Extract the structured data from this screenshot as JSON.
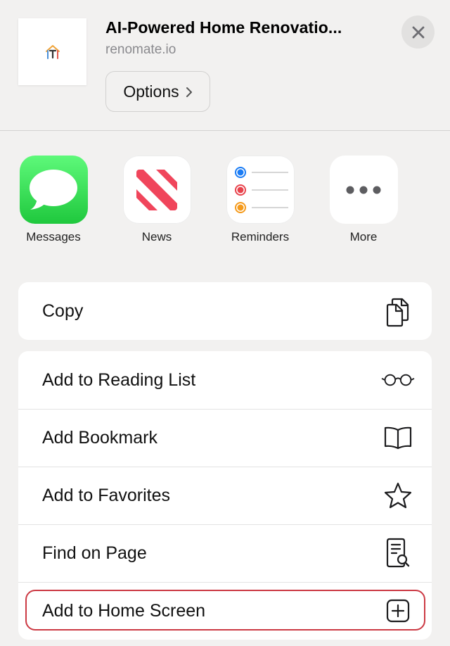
{
  "header": {
    "title": "AI-Powered Home Renovatio...",
    "domain": "renomate.io",
    "options_label": "Options",
    "options_icon": "chevron-right-icon",
    "close_icon": "close-icon"
  },
  "apps": [
    {
      "label": "Messages",
      "icon": "messages-icon"
    },
    {
      "label": "News",
      "icon": "news-icon"
    },
    {
      "label": "Reminders",
      "icon": "reminders-icon"
    },
    {
      "label": "More",
      "icon": "more-icon"
    }
  ],
  "actions_group_1": [
    {
      "label": "Copy",
      "icon": "copy-icon"
    }
  ],
  "actions_group_2": [
    {
      "label": "Add to Reading List",
      "icon": "glasses-icon"
    },
    {
      "label": "Add Bookmark",
      "icon": "book-icon"
    },
    {
      "label": "Add to Favorites",
      "icon": "star-icon"
    },
    {
      "label": "Find on Page",
      "icon": "find-page-icon"
    },
    {
      "label": "Add to Home Screen",
      "icon": "add-square-icon",
      "highlighted": true
    }
  ],
  "colors": {
    "background": "#f2f1f0",
    "highlight": "#cc3a44",
    "messages_green": "#1fc83d",
    "news_red": "#f0455b",
    "reminder_blue": "#1a7cf5",
    "reminder_red": "#e8434c",
    "reminder_orange": "#f59a1b"
  }
}
